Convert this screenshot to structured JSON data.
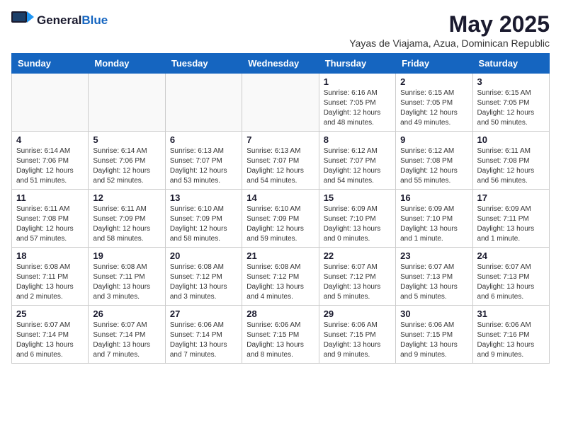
{
  "logo": {
    "general": "General",
    "blue": "Blue"
  },
  "title": "May 2025",
  "subtitle": "Yayas de Viajama, Azua, Dominican Republic",
  "weekdays": [
    "Sunday",
    "Monday",
    "Tuesday",
    "Wednesday",
    "Thursday",
    "Friday",
    "Saturday"
  ],
  "weeks": [
    [
      {
        "day": "",
        "info": ""
      },
      {
        "day": "",
        "info": ""
      },
      {
        "day": "",
        "info": ""
      },
      {
        "day": "",
        "info": ""
      },
      {
        "day": "1",
        "info": "Sunrise: 6:16 AM\nSunset: 7:05 PM\nDaylight: 12 hours\nand 48 minutes."
      },
      {
        "day": "2",
        "info": "Sunrise: 6:15 AM\nSunset: 7:05 PM\nDaylight: 12 hours\nand 49 minutes."
      },
      {
        "day": "3",
        "info": "Sunrise: 6:15 AM\nSunset: 7:05 PM\nDaylight: 12 hours\nand 50 minutes."
      }
    ],
    [
      {
        "day": "4",
        "info": "Sunrise: 6:14 AM\nSunset: 7:06 PM\nDaylight: 12 hours\nand 51 minutes."
      },
      {
        "day": "5",
        "info": "Sunrise: 6:14 AM\nSunset: 7:06 PM\nDaylight: 12 hours\nand 52 minutes."
      },
      {
        "day": "6",
        "info": "Sunrise: 6:13 AM\nSunset: 7:07 PM\nDaylight: 12 hours\nand 53 minutes."
      },
      {
        "day": "7",
        "info": "Sunrise: 6:13 AM\nSunset: 7:07 PM\nDaylight: 12 hours\nand 54 minutes."
      },
      {
        "day": "8",
        "info": "Sunrise: 6:12 AM\nSunset: 7:07 PM\nDaylight: 12 hours\nand 54 minutes."
      },
      {
        "day": "9",
        "info": "Sunrise: 6:12 AM\nSunset: 7:08 PM\nDaylight: 12 hours\nand 55 minutes."
      },
      {
        "day": "10",
        "info": "Sunrise: 6:11 AM\nSunset: 7:08 PM\nDaylight: 12 hours\nand 56 minutes."
      }
    ],
    [
      {
        "day": "11",
        "info": "Sunrise: 6:11 AM\nSunset: 7:08 PM\nDaylight: 12 hours\nand 57 minutes."
      },
      {
        "day": "12",
        "info": "Sunrise: 6:11 AM\nSunset: 7:09 PM\nDaylight: 12 hours\nand 58 minutes."
      },
      {
        "day": "13",
        "info": "Sunrise: 6:10 AM\nSunset: 7:09 PM\nDaylight: 12 hours\nand 58 minutes."
      },
      {
        "day": "14",
        "info": "Sunrise: 6:10 AM\nSunset: 7:09 PM\nDaylight: 12 hours\nand 59 minutes."
      },
      {
        "day": "15",
        "info": "Sunrise: 6:09 AM\nSunset: 7:10 PM\nDaylight: 13 hours\nand 0 minutes."
      },
      {
        "day": "16",
        "info": "Sunrise: 6:09 AM\nSunset: 7:10 PM\nDaylight: 13 hours\nand 1 minute."
      },
      {
        "day": "17",
        "info": "Sunrise: 6:09 AM\nSunset: 7:11 PM\nDaylight: 13 hours\nand 1 minute."
      }
    ],
    [
      {
        "day": "18",
        "info": "Sunrise: 6:08 AM\nSunset: 7:11 PM\nDaylight: 13 hours\nand 2 minutes."
      },
      {
        "day": "19",
        "info": "Sunrise: 6:08 AM\nSunset: 7:11 PM\nDaylight: 13 hours\nand 3 minutes."
      },
      {
        "day": "20",
        "info": "Sunrise: 6:08 AM\nSunset: 7:12 PM\nDaylight: 13 hours\nand 3 minutes."
      },
      {
        "day": "21",
        "info": "Sunrise: 6:08 AM\nSunset: 7:12 PM\nDaylight: 13 hours\nand 4 minutes."
      },
      {
        "day": "22",
        "info": "Sunrise: 6:07 AM\nSunset: 7:12 PM\nDaylight: 13 hours\nand 5 minutes."
      },
      {
        "day": "23",
        "info": "Sunrise: 6:07 AM\nSunset: 7:13 PM\nDaylight: 13 hours\nand 5 minutes."
      },
      {
        "day": "24",
        "info": "Sunrise: 6:07 AM\nSunset: 7:13 PM\nDaylight: 13 hours\nand 6 minutes."
      }
    ],
    [
      {
        "day": "25",
        "info": "Sunrise: 6:07 AM\nSunset: 7:14 PM\nDaylight: 13 hours\nand 6 minutes."
      },
      {
        "day": "26",
        "info": "Sunrise: 6:07 AM\nSunset: 7:14 PM\nDaylight: 13 hours\nand 7 minutes."
      },
      {
        "day": "27",
        "info": "Sunrise: 6:06 AM\nSunset: 7:14 PM\nDaylight: 13 hours\nand 7 minutes."
      },
      {
        "day": "28",
        "info": "Sunrise: 6:06 AM\nSunset: 7:15 PM\nDaylight: 13 hours\nand 8 minutes."
      },
      {
        "day": "29",
        "info": "Sunrise: 6:06 AM\nSunset: 7:15 PM\nDaylight: 13 hours\nand 9 minutes."
      },
      {
        "day": "30",
        "info": "Sunrise: 6:06 AM\nSunset: 7:15 PM\nDaylight: 13 hours\nand 9 minutes."
      },
      {
        "day": "31",
        "info": "Sunrise: 6:06 AM\nSunset: 7:16 PM\nDaylight: 13 hours\nand 9 minutes."
      }
    ]
  ]
}
